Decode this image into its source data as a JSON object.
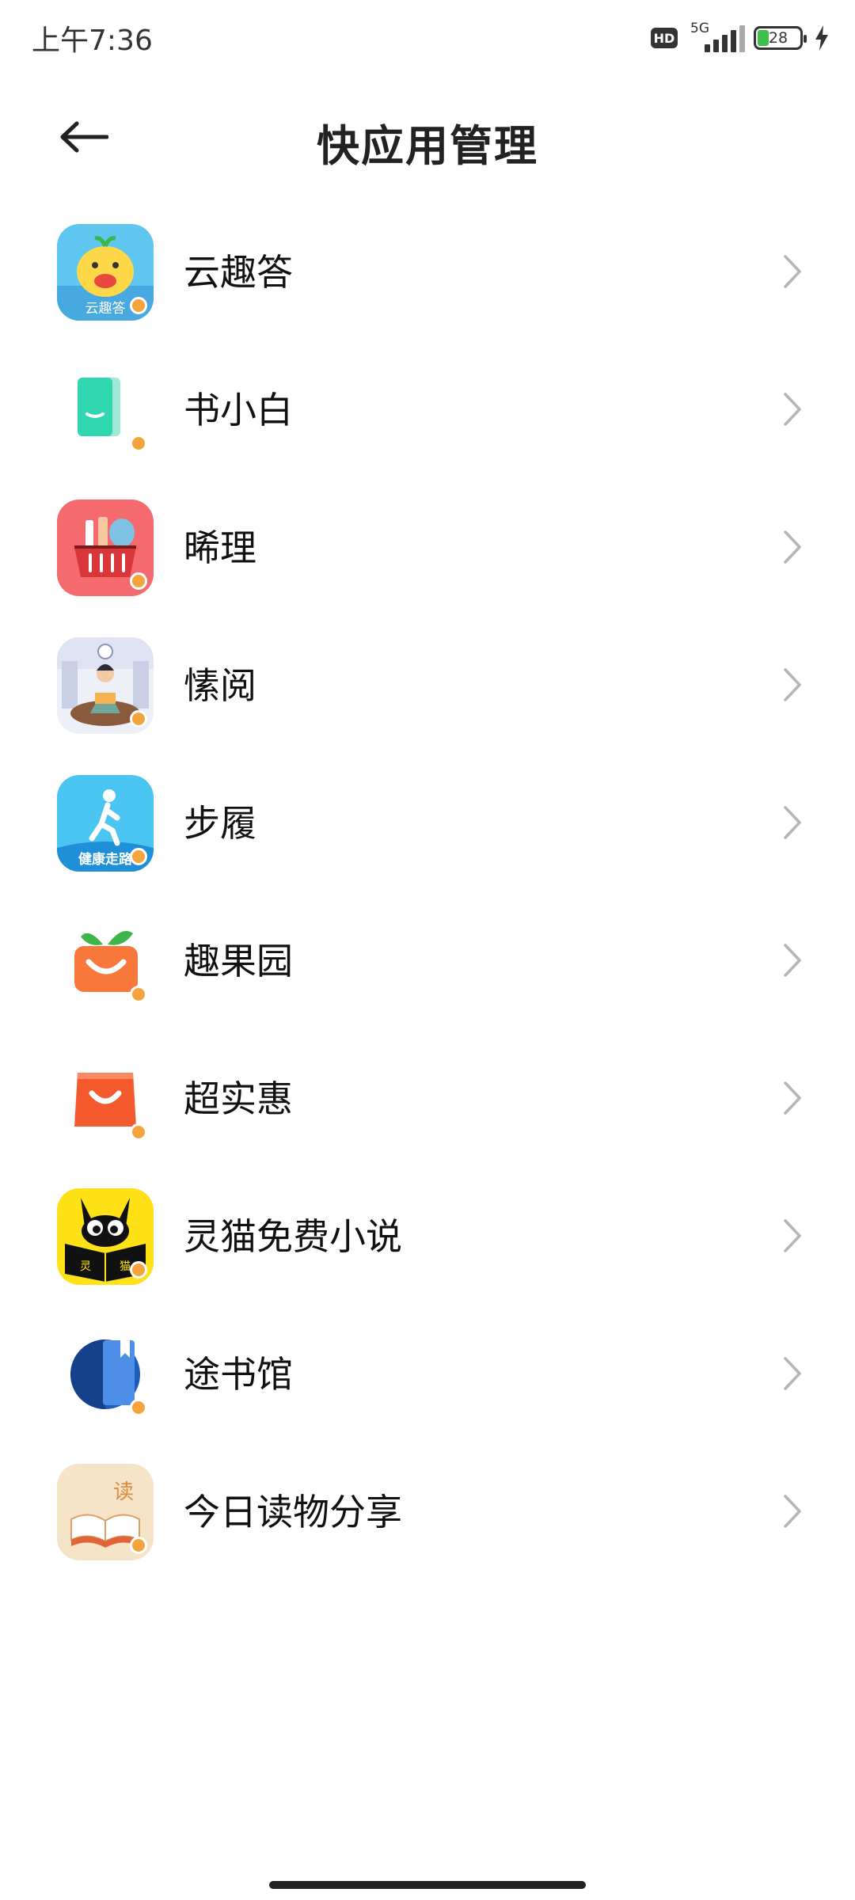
{
  "status_bar": {
    "time": "上午7:36",
    "hd_label": "HD",
    "network_label": "5G",
    "battery_level": "28"
  },
  "header": {
    "title": "快应用管理",
    "back_icon": "back-arrow-icon"
  },
  "apps": [
    {
      "label": "云趣答",
      "icon": "yunqu-app-icon",
      "icon_text": "云趣答"
    },
    {
      "label": "书小白",
      "icon": "shuxiaobai-app-icon"
    },
    {
      "label": "晞理",
      "icon": "xili-app-icon"
    },
    {
      "label": "愫阅",
      "icon": "suyue-app-icon"
    },
    {
      "label": "步履",
      "icon": "bulv-app-icon",
      "icon_text": "健康走路"
    },
    {
      "label": "趣果园",
      "icon": "quguoyuan-app-icon"
    },
    {
      "label": "超实惠",
      "icon": "chaoshihui-app-icon"
    },
    {
      "label": "灵猫免费小说",
      "icon": "lingmao-app-icon",
      "icon_text_left": "灵",
      "icon_text_right": "猫"
    },
    {
      "label": "途书馆",
      "icon": "tushuguan-app-icon"
    },
    {
      "label": "今日读物分享",
      "icon": "jinri-app-icon",
      "icon_text": "读"
    }
  ],
  "colors": {
    "accent_orange": "#f5a33c",
    "text": "#111111",
    "chevron": "#b5b5b5"
  }
}
